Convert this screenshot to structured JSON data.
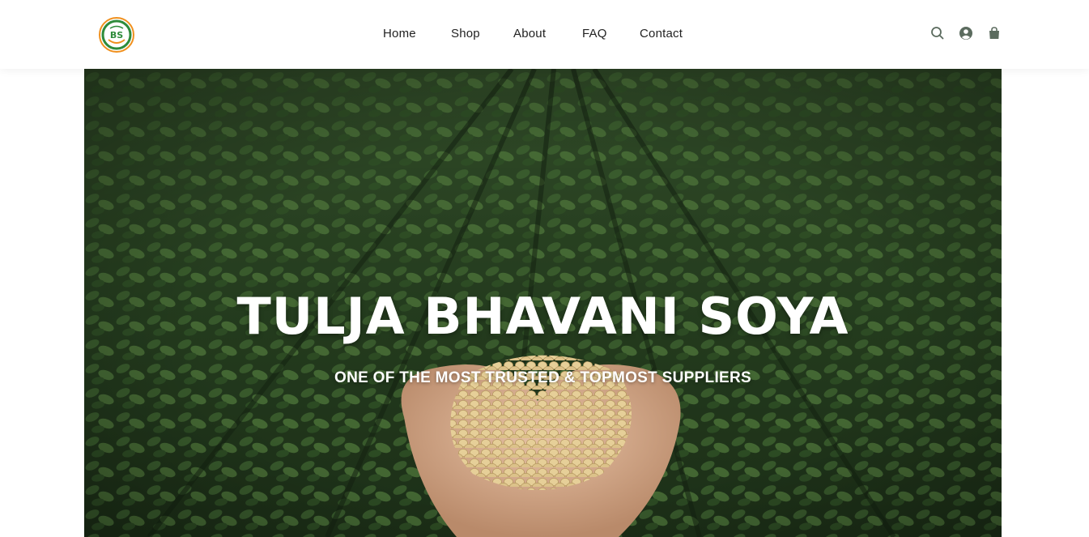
{
  "brand": {
    "logo_icon": "tulja-bhavani-soya-logo",
    "logo_text": "BS",
    "colors": {
      "green": "#2e8b3a",
      "orange": "#f0901e"
    }
  },
  "nav": {
    "items": [
      {
        "label": "Home"
      },
      {
        "label": "Shop"
      },
      {
        "label": "About"
      },
      {
        "label": "FAQ"
      },
      {
        "label": "Contact"
      }
    ]
  },
  "header_icons": {
    "search": "search-icon",
    "account": "user-circle-icon",
    "cart": "shopping-bag-icon",
    "icon_color": "#5b6b5e"
  },
  "hero": {
    "title": "TULJA BHAVANI SOYA",
    "subtitle": "ONE OF THE MOST TRUSTED & TOPMOST SUPPLIERS",
    "background": "soybean-field-with-hands-holding-beans"
  }
}
